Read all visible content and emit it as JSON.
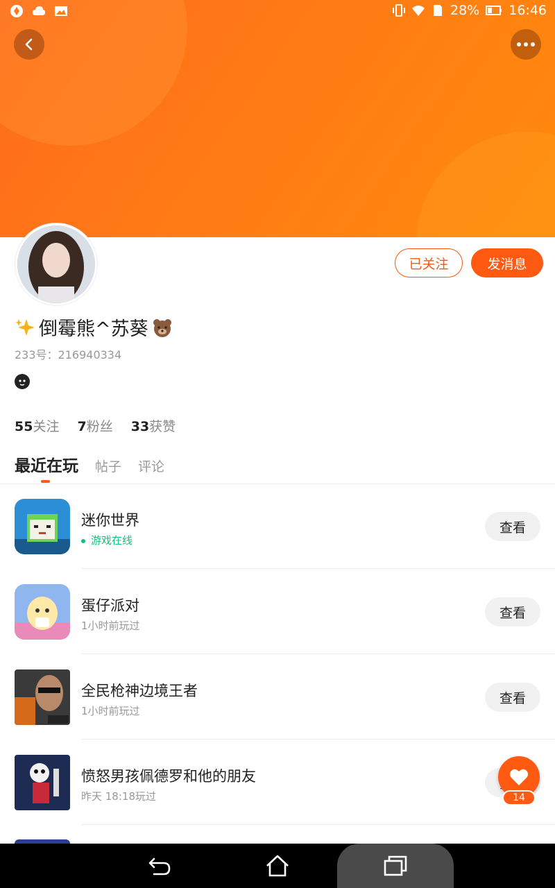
{
  "status_bar": {
    "battery": "28%",
    "time": "16:46"
  },
  "profile": {
    "name": "倒霉熊^苏葵",
    "uid": "233号：216940334",
    "follow_button": "已关注",
    "message_button": "发消息"
  },
  "stats": [
    {
      "count": "55",
      "label": "关注"
    },
    {
      "count": "7",
      "label": "粉丝"
    },
    {
      "count": "33",
      "label": "获赞"
    }
  ],
  "tabs": [
    "最近在玩",
    "帖子",
    "评论"
  ],
  "games": [
    {
      "title": "迷你世界",
      "status": "游戏在线",
      "online": true,
      "button": "查看"
    },
    {
      "title": "蛋仔派对",
      "status": "1小时前玩过",
      "online": false,
      "button": "查看"
    },
    {
      "title": "全民枪神边境王者",
      "status": "1小时前玩过",
      "online": false,
      "button": "查看"
    },
    {
      "title": "愤怒男孩佩德罗和他的朋友",
      "status": "昨天 18:18玩过",
      "online": false,
      "button": "查看"
    }
  ],
  "fab": {
    "count": "14"
  },
  "colors": {
    "accent": "#ff5a12",
    "online": "#17c07a",
    "hero": "#ff7b16"
  }
}
